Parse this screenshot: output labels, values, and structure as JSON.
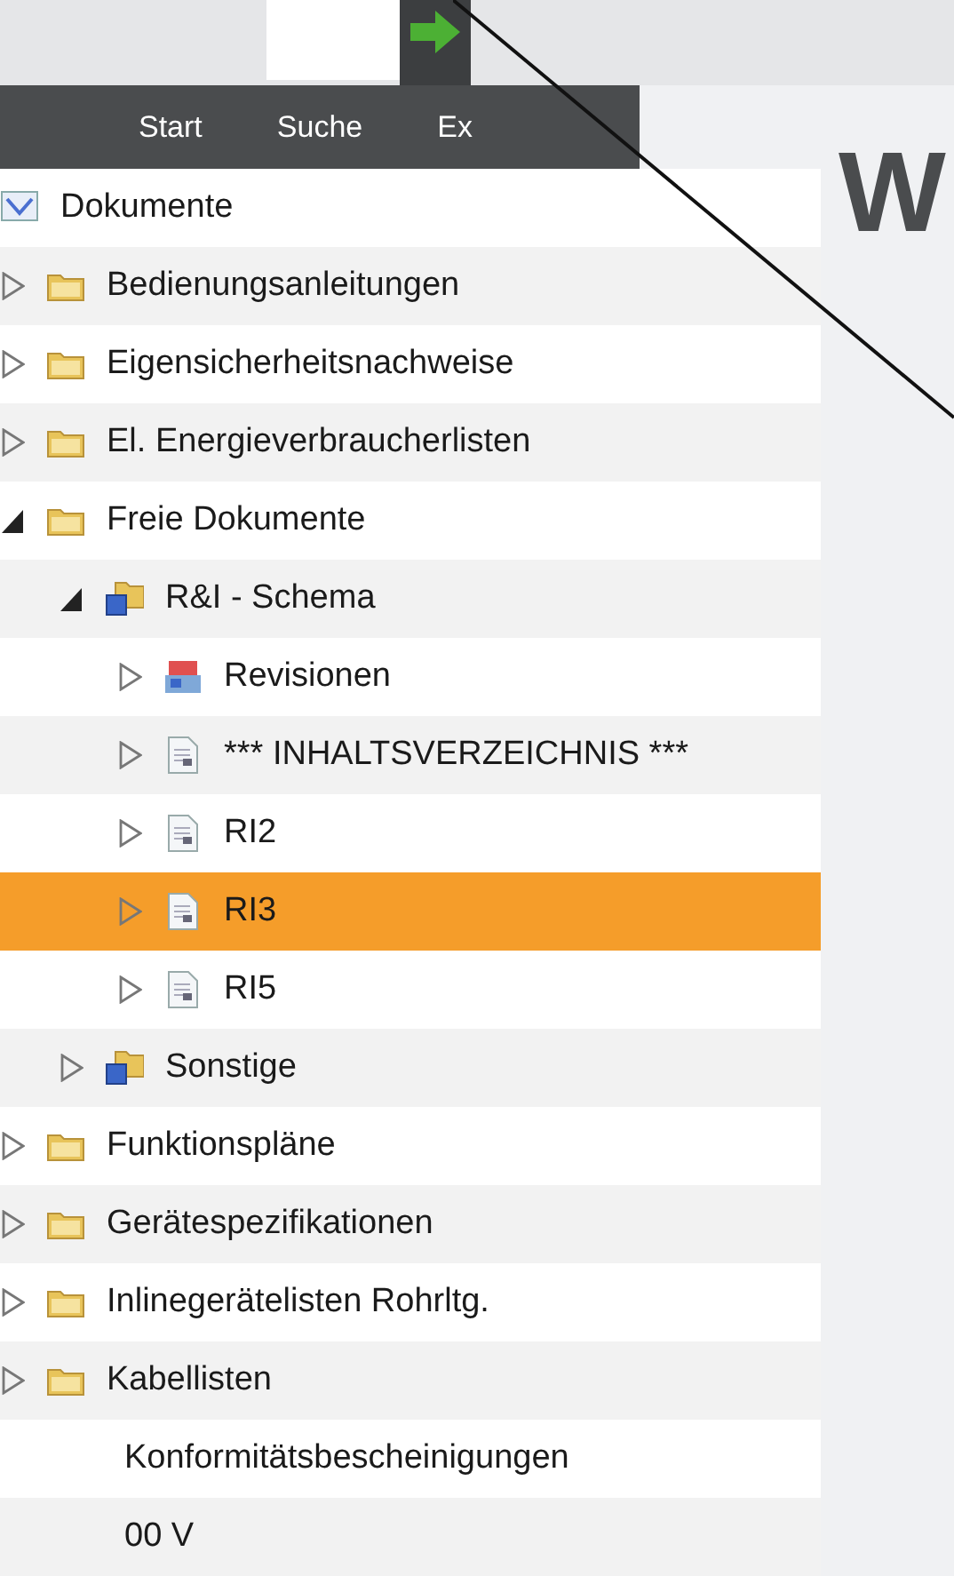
{
  "menu": [
    {
      "label": "Start"
    },
    {
      "label": "Suche"
    },
    {
      "label": "Ex"
    }
  ],
  "heading": "W",
  "tree": [
    {
      "label": "Dokumente",
      "kind": "root",
      "selected": false,
      "children": [
        {
          "label": "Bedienungsanleitungen",
          "kind": "folder",
          "expanded": false,
          "selected": false
        },
        {
          "label": "Eigensicherheitsnachweise",
          "kind": "folder",
          "expanded": false,
          "selected": false
        },
        {
          "label": "El. Energieverbraucherlisten",
          "kind": "folder",
          "expanded": false,
          "selected": false
        },
        {
          "label": "Freie Dokumente",
          "kind": "folder",
          "expanded": true,
          "selected": false,
          "children": [
            {
              "label": "R&I - Schema",
              "kind": "stack",
              "expanded": true,
              "selected": false,
              "children": [
                {
                  "label": "Revisionen",
                  "kind": "revisions",
                  "expanded": false,
                  "selected": false
                },
                {
                  "label": "*** INHALTSVERZEICHNIS ***",
                  "kind": "document",
                  "expanded": false,
                  "selected": false
                },
                {
                  "label": "RI2",
                  "kind": "document",
                  "expanded": false,
                  "selected": false
                },
                {
                  "label": "RI3",
                  "kind": "document",
                  "expanded": false,
                  "selected": true
                },
                {
                  "label": "RI5",
                  "kind": "document",
                  "expanded": false,
                  "selected": false
                }
              ]
            },
            {
              "label": "Sonstige",
              "kind": "stack",
              "expanded": false,
              "selected": false
            }
          ]
        },
        {
          "label": "Funktionspläne",
          "kind": "folder",
          "expanded": false,
          "selected": false
        },
        {
          "label": "Gerätespezifikationen",
          "kind": "folder",
          "expanded": false,
          "selected": false
        },
        {
          "label": "Inlinegerätelisten Rohrltg.",
          "kind": "folder",
          "expanded": false,
          "selected": false
        },
        {
          "label": "Kabellisten",
          "kind": "folder",
          "expanded": false,
          "selected": false
        },
        {
          "label": "Konformitätsbescheinigungen",
          "kind": "partial",
          "selected": false
        },
        {
          "label": "00 V",
          "kind": "partial",
          "selected": false
        }
      ]
    }
  ]
}
